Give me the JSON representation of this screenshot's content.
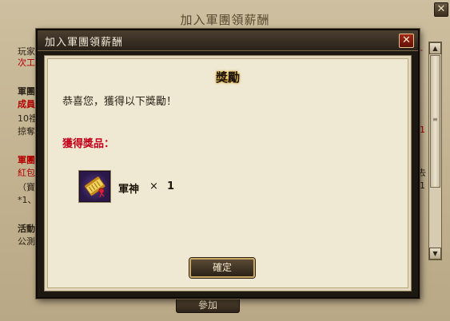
{
  "background": {
    "title": "加入軍團領薪酬",
    "close_glyph": "✕",
    "lines": [
      {
        "text": "玩家",
        "style": "plain"
      },
      {
        "text": "次工",
        "style": "red-plain"
      },
      {
        "text": "軍團",
        "style": "bold"
      },
      {
        "text": "成員",
        "style": "red"
      },
      {
        "text": "10禮",
        "style": "plain"
      },
      {
        "text": "掠奪",
        "style": "plain"
      },
      {
        "text": "軍團",
        "style": "red"
      },
      {
        "text": "紅包",
        "style": "red-plain"
      },
      {
        "text": "（寶",
        "style": "plain"
      },
      {
        "text": "*1、",
        "style": "plain"
      },
      {
        "text": "活動",
        "style": "bold"
      },
      {
        "text": "公測",
        "style": "plain"
      }
    ],
    "right_fragments": [
      "-",
      "1",
      "去",
      "1"
    ],
    "join_button": "參加",
    "scroll_up": "▲",
    "scroll_down": "▼",
    "scroll_grip": "≡"
  },
  "dialog": {
    "title": "加入軍團領薪酬",
    "close_glyph": "✕",
    "heading": "獎勵",
    "message": "恭喜您，獲得以下獎勵！",
    "reward_label": "獲得獎品：",
    "item": {
      "name": "軍神",
      "multiplier": "×",
      "quantity": "1",
      "icon": "scroll-icon"
    },
    "confirm_button": "確定"
  },
  "colors": {
    "accent_red": "#c4001a",
    "panel_bg": "#efe8d3",
    "titlebar": "#2a2119",
    "button_border": "#c8a862"
  }
}
